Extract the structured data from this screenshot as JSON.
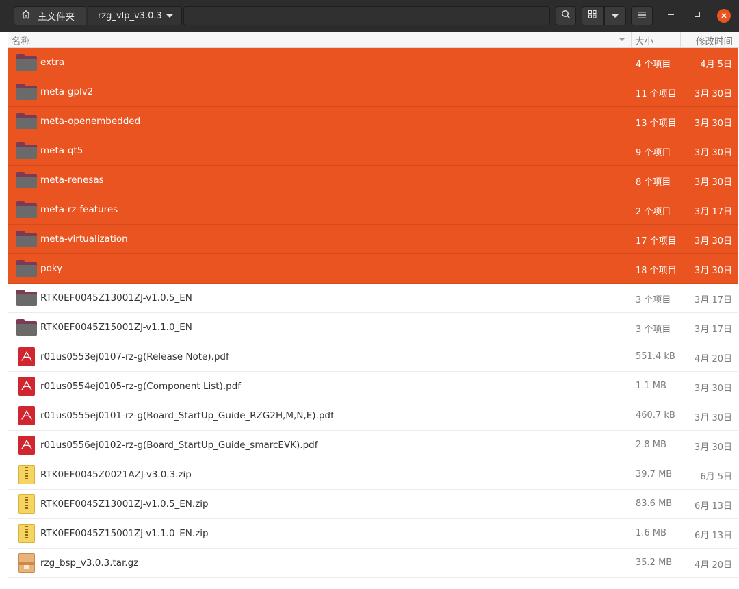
{
  "header": {
    "home_label": "主文件夹",
    "current_folder": "rzg_vlp_v3.0.3",
    "icons": {
      "home": "home-icon",
      "search": "search-icon",
      "view": "grid-view-icon",
      "view_menu": "chevron-down-icon",
      "menu": "hamburger-menu-icon",
      "minimize": "minimize-icon",
      "maximize": "maximize-icon",
      "close": "close-icon"
    },
    "accent_color": "#e95420"
  },
  "columns": {
    "name": "名称",
    "size": "大小",
    "modified": "修改时间"
  },
  "files": [
    {
      "name": "extra",
      "size": "4 个项目",
      "date": "4月 5日",
      "type": "folder",
      "selected": true
    },
    {
      "name": "meta-gplv2",
      "size": "11 个项目",
      "date": "3月 30日",
      "type": "folder",
      "selected": true
    },
    {
      "name": "meta-openembedded",
      "size": "13 个项目",
      "date": "3月 30日",
      "type": "folder",
      "selected": true
    },
    {
      "name": "meta-qt5",
      "size": "9 个项目",
      "date": "3月 30日",
      "type": "folder",
      "selected": true
    },
    {
      "name": "meta-renesas",
      "size": "8 个项目",
      "date": "3月 30日",
      "type": "folder",
      "selected": true
    },
    {
      "name": "meta-rz-features",
      "size": "2 个项目",
      "date": "3月 17日",
      "type": "folder",
      "selected": true
    },
    {
      "name": "meta-virtualization",
      "size": "17 个项目",
      "date": "3月 30日",
      "type": "folder",
      "selected": true
    },
    {
      "name": "poky",
      "size": "18 个项目",
      "date": "3月 30日",
      "type": "folder",
      "selected": true
    },
    {
      "name": "RTK0EF0045Z13001ZJ-v1.0.5_EN",
      "size": "3 个项目",
      "date": "3月 17日",
      "type": "folder",
      "selected": false
    },
    {
      "name": "RTK0EF0045Z15001ZJ-v1.1.0_EN",
      "size": "3 个项目",
      "date": "3月 17日",
      "type": "folder",
      "selected": false
    },
    {
      "name": "r01us0553ej0107-rz-g(Release Note).pdf",
      "size": "551.4 kB",
      "date": "4月 20日",
      "type": "pdf",
      "selected": false
    },
    {
      "name": "r01us0554ej0105-rz-g(Component List).pdf",
      "size": "1.1 MB",
      "date": "3月 30日",
      "type": "pdf",
      "selected": false
    },
    {
      "name": "r01us0555ej0101-rz-g(Board_StartUp_Guide_RZG2H,M,N,E).pdf",
      "size": "460.7 kB",
      "date": "3月 30日",
      "type": "pdf",
      "selected": false
    },
    {
      "name": "r01us0556ej0102-rz-g(Board_StartUp_Guide_smarcEVK).pdf",
      "size": "2.8 MB",
      "date": "3月 30日",
      "type": "pdf",
      "selected": false
    },
    {
      "name": "RTK0EF0045Z0021AZJ-v3.0.3.zip",
      "size": "39.7 MB",
      "date": "6月 5日",
      "type": "zip",
      "selected": false
    },
    {
      "name": "RTK0EF0045Z13001ZJ-v1.0.5_EN.zip",
      "size": "83.6 MB",
      "date": "6月 13日",
      "type": "zip",
      "selected": false
    },
    {
      "name": "RTK0EF0045Z15001ZJ-v1.1.0_EN.zip",
      "size": "1.6 MB",
      "date": "6月 13日",
      "type": "zip",
      "selected": false
    },
    {
      "name": "rzg_bsp_v3.0.3.tar.gz",
      "size": "35.2 MB",
      "date": "4月 20日",
      "type": "tgz",
      "selected": false
    }
  ]
}
